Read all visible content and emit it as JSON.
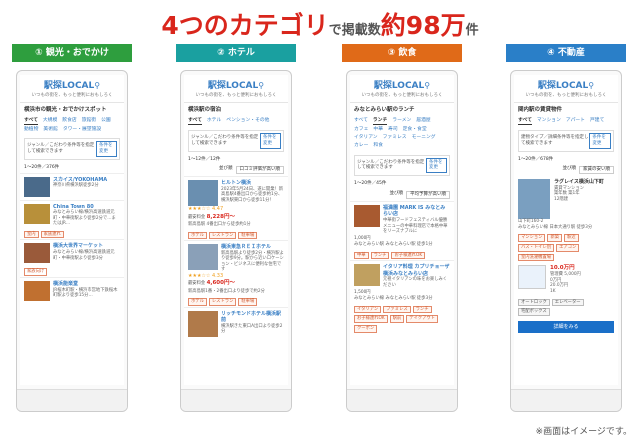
{
  "headline": {
    "part1": "4つのカテゴリ",
    "part2": "で掲載数",
    "part3": "約98万",
    "part4": "件"
  },
  "footnote": "※画面はイメージです。",
  "app": {
    "logo": "駅探LOCAL",
    "tagline": "いつもの街を、もっと便利におもしろく",
    "change_btn": "条件を変更",
    "filter_text": "ジャンル／こだわり条件等を指定して検索できます"
  },
  "colors": {
    "green": "#2e9e3e",
    "teal": "#1aa0a0",
    "orange": "#e06a18",
    "blue": "#2a7fc8"
  },
  "categories": [
    {
      "label": "① 観光・おでかけ",
      "section": "横浜市の観光・おでかけスポット",
      "tabs": [
        "すべて",
        "大規模",
        "飲食店",
        "旅館街",
        "公園",
        "動植物",
        "美術館",
        "タワー・展望施設"
      ],
      "count": "1〜20件／376件",
      "items": [
        {
          "title": "スカイス/YOKOHAMA",
          "desc": "神奈川県横浜駅徒歩2分"
        },
        {
          "title": "China Town 80",
          "desc": "みなとみらい線/横浜高速鉄道元町・中華街駅より徒歩2分で…またはJR…"
        },
        {
          "title": "横浜大世界マーケット",
          "desc": "みなとみらい線/横浜高速鉄道元町・中華街駅より徒歩3分"
        },
        {
          "title": "横浜能楽堂",
          "desc": "JR桜木町駅・横浜市営地下鉄桜木町駅より徒歩15分…"
        }
      ],
      "chips": [
        "室内",
        "家族連れ"
      ],
      "fav": "家族向け"
    },
    {
      "label": "② ホテル",
      "section": "横浜駅の宿泊",
      "tabs": [
        "すべて",
        "ホテル",
        "ペンション・その他"
      ],
      "count": "1〜12件／12件",
      "sort_label": "並び順",
      "sort": "口コミ評価が高い順",
      "items": [
        {
          "title": "ヒルトン横浜",
          "desc": "2023年5月24日、遂に開業！新高島駅4番出口から徒歩約1分、横浜駅東口から徒歩11分！",
          "rating": "★★★☆☆ 4.47",
          "price_label": "最安料金",
          "price": "8,228円〜",
          "access": "新高島駅 4番出口から徒歩約1分"
        },
        {
          "title": "横浜東急ＲＥＩホテル",
          "desc": "新高島駅より徒歩2分・横浜駅より徒歩9分。駅から近いロケーション・ビジネスに便利な住宅です",
          "rating": "★★★☆☆ 4.33",
          "price_label": "最安料金",
          "price": "4,600円〜",
          "access": "新高島駅1番・2番出口より徒歩で約2分"
        },
        {
          "title": "リッチモンドホテル横浜駅前",
          "desc": "横浜駅きた東口A出口より徒歩2分"
        }
      ],
      "chips": [
        "ホテル",
        "レストラン",
        "駐車場"
      ]
    },
    {
      "label": "③ 飲食",
      "section": "みなとみらい駅のランチ",
      "tabs": [
        "すべて",
        "ランチ",
        "ラーメン",
        "居酒屋",
        "カフェ",
        "中華",
        "寿司",
        "定食・食堂",
        "イタリアン",
        "ファミレス",
        "モーニング",
        "カレー",
        "和食"
      ],
      "count": "1〜20件／45件",
      "sort_label": "並び順",
      "sort": "平均予算が高い順",
      "items": [
        {
          "title": "福満園 MARK IS みなとみらい店",
          "desc": "中華街フードフェスティバル優勝メニューの中華料理店で本格中華をリーズナブルに",
          "price": "1,000円",
          "access": "みなとみらい駅 みなとみらい駅 徒歩1分"
        },
        {
          "title": "イタリア料理 カプリチョーザ 横浜みなとみらい店",
          "desc": "元祖イタリアンの味をお楽しみください",
          "price": "1,500円",
          "access": "みなとみらい線 みなとみらい駅 徒歩3分"
        }
      ],
      "chips1": [
        "中華",
        "ランチ",
        "お子様連れOK"
      ],
      "chips2": [
        "イタリアン",
        "ファミレス",
        "ランチ",
        "お子様連れOK",
        "駅前",
        "テイクアウト",
        "クーポン"
      ]
    },
    {
      "label": "④ 不動産",
      "section": "関内駅の賃貸物件",
      "tabs": [
        "すべて",
        "マンション",
        "アパート",
        "戸建て"
      ],
      "count": "1〜20件／678件",
      "sort_label": "並び順",
      "sort": "家賃の安い順",
      "filter_text": "建物タイプ／詳細条件等を指定して検索できます",
      "item": {
        "title": "ラグレイス横浜山下町",
        "type": "賃貸マンション",
        "built": "築年数 築1年",
        "floors": "12階建",
        "address": "山下町160-2",
        "station": "みなとみらい線 日本大通り駅 徒歩3分",
        "rent": "10.0万円",
        "mgmt": "管理費 5,000円",
        "deposit": "0万円",
        "key": "20.0万円",
        "layout": "1K"
      },
      "chips": [
        "マンション",
        "新築",
        "駅近",
        "バス・トイレ別",
        "エアコン",
        "室内洗濯機置場",
        "オートロック",
        "エレベーター",
        "宅配ボックス"
      ],
      "details_btn": "詳細をみる"
    }
  ]
}
